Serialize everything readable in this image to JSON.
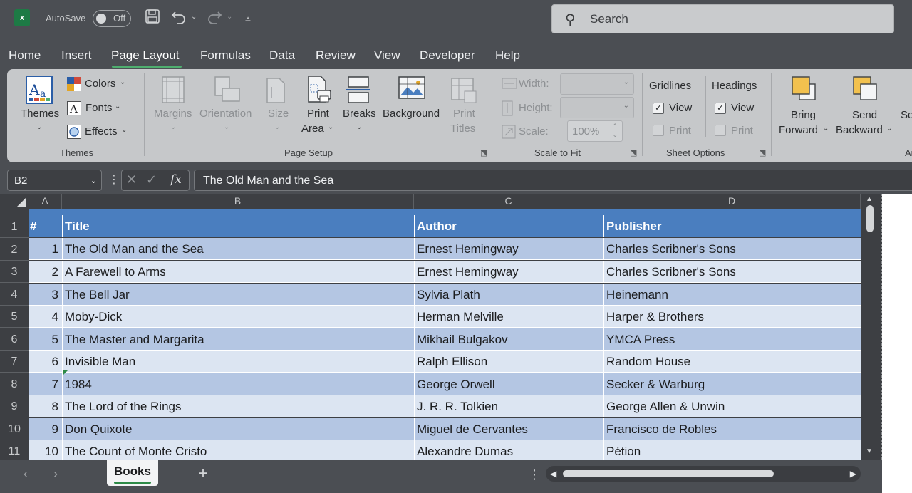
{
  "app": {
    "logo_letter": "x",
    "autosave_label": "AutoSave",
    "autosave_state": "Off",
    "search_placeholder": "Search"
  },
  "tabs": [
    "Home",
    "Insert",
    "Page Layout",
    "Formulas",
    "Data",
    "Review",
    "View",
    "Developer",
    "Help"
  ],
  "active_tab": "Page Layout",
  "ribbon": {
    "themes": {
      "themes_label": "Themes",
      "colors_label": "Colors",
      "fonts_label": "Fonts",
      "effects_label": "Effects",
      "group_label": "Themes"
    },
    "page_setup": {
      "margins_label": "Margins",
      "orientation_label": "Orientation",
      "size_label": "Size",
      "print_area_label1": "Print",
      "print_area_label2": "Area",
      "breaks_label": "Breaks",
      "background_label": "Background",
      "print_titles_label1": "Print",
      "print_titles_label2": "Titles",
      "group_label": "Page Setup"
    },
    "scale_to_fit": {
      "width_label": "Width:",
      "height_label": "Height:",
      "scale_label": "Scale:",
      "scale_value": "100%",
      "group_label": "Scale to Fit"
    },
    "sheet_options": {
      "gridlines_label": "Gridlines",
      "headings_label": "Headings",
      "view_label": "View",
      "print_label": "Print",
      "gridlines_view_checked": true,
      "headings_view_checked": true,
      "group_label": "Sheet Options"
    },
    "arrange": {
      "bring_forward_label1": "Bring",
      "bring_forward_label2": "Forward",
      "send_backward_label1": "Send",
      "send_backward_label2": "Backward",
      "partial_label": "Se",
      "partial_group": "Ar"
    }
  },
  "formula_bar": {
    "name_box": "B2",
    "fx_label": "fx",
    "content": "The Old Man and the Sea"
  },
  "grid": {
    "columns": [
      "A",
      "B",
      "C",
      "D"
    ],
    "header_row": {
      "num": "#",
      "title": "Title",
      "author": "Author",
      "publisher": "Publisher"
    },
    "row_numbers": [
      "1",
      "2",
      "3",
      "4",
      "5",
      "6",
      "7",
      "8",
      "9",
      "10",
      "11"
    ],
    "rows": [
      {
        "num": "1",
        "title": "The Old Man and the Sea",
        "author": "Ernest Hemingway",
        "publisher": "Charles Scribner's Sons"
      },
      {
        "num": "2",
        "title": "A Farewell to Arms",
        "author": "Ernest Hemingway",
        "publisher": "Charles Scribner's Sons"
      },
      {
        "num": "3",
        "title": "The Bell Jar",
        "author": "Sylvia Plath",
        "publisher": "Heinemann"
      },
      {
        "num": "4",
        "title": "Moby-Dick",
        "author": "Herman Melville",
        "publisher": "Harper & Brothers"
      },
      {
        "num": "5",
        "title": "The Master and Margarita",
        "author": "Mikhail Bulgakov",
        "publisher": "YMCA Press"
      },
      {
        "num": "6",
        "title": "Invisible Man",
        "author": "Ralph Ellison",
        "publisher": "Random House"
      },
      {
        "num": "7",
        "title": "1984",
        "author": "George Orwell",
        "publisher": "Secker & Warburg"
      },
      {
        "num": "8",
        "title": "The Lord of the Rings",
        "author": "J. R. R. Tolkien",
        "publisher": "George Allen & Unwin"
      },
      {
        "num": "9",
        "title": "Don Quixote",
        "author": "Miguel de Cervantes",
        "publisher": "Francisco de Robles"
      },
      {
        "num": "10",
        "title": "The Count of Monte Cristo",
        "author": "Alexandre Dumas",
        "publisher": "Pétion"
      }
    ]
  },
  "sheet_tabs": [
    "Books"
  ],
  "colors": {
    "header_fill": "#4a7ebf",
    "band_dark": "#b4c6e3",
    "band_light": "#dce5f2",
    "accent": "#4fae6f"
  }
}
